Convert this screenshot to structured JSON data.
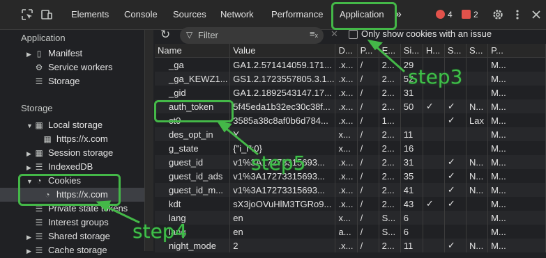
{
  "toolbar_icons": [
    "inspect-icon",
    "device-toggle-icon"
  ],
  "tabs": [
    {
      "label": "Elements"
    },
    {
      "label": "Console"
    },
    {
      "label": "Sources"
    },
    {
      "label": "Network"
    },
    {
      "label": "Performance"
    },
    {
      "label": "Application"
    }
  ],
  "more_tabs": "»",
  "errors": {
    "count": "4",
    "color": "#e2524b"
  },
  "issues": {
    "count": "2",
    "color": "#e2524b"
  },
  "sidebar": {
    "application_heading": "Application",
    "application_items": [
      {
        "label": "Manifest",
        "icon": "document-icon"
      },
      {
        "label": "Service workers",
        "icon": "gear-icon"
      },
      {
        "label": "Storage",
        "icon": "database-icon"
      }
    ],
    "storage_heading": "Storage",
    "storage_items": [
      {
        "label": "Local storage",
        "icon": "grid-icon"
      },
      {
        "label": "https://x.com",
        "icon": "grid-icon"
      },
      {
        "label": "Session storage",
        "icon": "grid-icon"
      },
      {
        "label": "IndexedDB",
        "icon": "database-icon"
      },
      {
        "label": "Cookies",
        "icon": "cookie-icon"
      },
      {
        "label": "https://x.com",
        "icon": "cookie-icon"
      },
      {
        "label": "Private state tokens",
        "icon": "database-icon"
      },
      {
        "label": "Interest groups",
        "icon": "database-icon"
      },
      {
        "label": "Shared storage",
        "icon": "database-icon"
      },
      {
        "label": "Cache storage",
        "icon": "database-icon"
      }
    ]
  },
  "filter": {
    "placeholder": "Filter"
  },
  "issue_checkbox_label": "Only show cookies with an issue",
  "columns": [
    "Name",
    "Value",
    "D...",
    "P...",
    "E...",
    "Si...",
    "H...",
    "S...",
    "S...",
    "P..."
  ],
  "rows": [
    [
      "_ga",
      "GA1.2.571414059.171...",
      ".x...",
      "/",
      "2...",
      "29",
      "",
      "",
      "",
      "M..."
    ],
    [
      "_ga_KEWZ1...",
      "GS1.2.1723557805.3.1...",
      ".x...",
      "/",
      "2...",
      "52",
      "",
      "",
      "",
      "M..."
    ],
    [
      "_gid",
      "GA1.2.1892543147.17...",
      ".x...",
      "/",
      "2...",
      "31",
      "",
      "",
      "",
      "M..."
    ],
    [
      "auth_token",
      "5f45eda1b32ec30c38f...",
      ".x...",
      "/",
      "2...",
      "50",
      "✓",
      "✓",
      "N...",
      "M..."
    ],
    [
      "ct0",
      "3585a38c8af0b6d784...",
      ".x...",
      "/",
      "1...",
      "",
      "",
      "✓",
      "Lax",
      "M..."
    ],
    [
      "des_opt_in",
      "Y",
      "x...",
      "/",
      "2...",
      "11",
      "",
      "",
      "",
      "M..."
    ],
    [
      "g_state",
      "{\"i_l\":0}",
      "x...",
      "/",
      "2...",
      "16",
      "",
      "",
      "",
      "M..."
    ],
    [
      "guest_id",
      "v1%3A17273315693...",
      ".x...",
      "/",
      "2...",
      "31",
      "",
      "✓",
      "N...",
      "M..."
    ],
    [
      "guest_id_ads",
      "v1%3A17273315693...",
      ".x...",
      "/",
      "2...",
      "35",
      "",
      "✓",
      "N...",
      "M..."
    ],
    [
      "guest_id_m...",
      "v1%3A17273315693...",
      ".x...",
      "/",
      "2...",
      "41",
      "",
      "✓",
      "N...",
      "M..."
    ],
    [
      "kdt",
      "sX3joOVuHlM3TGRo9...",
      ".x...",
      "/",
      "2...",
      "43",
      "✓",
      "✓",
      "",
      "M..."
    ],
    [
      "lang",
      "en",
      "x...",
      "/",
      "S...",
      "6",
      "",
      "",
      "",
      "M..."
    ],
    [
      "lang",
      "en",
      "a...",
      "/",
      "S...",
      "6",
      "",
      "",
      "",
      "M..."
    ],
    [
      "night_mode",
      "2",
      ".x...",
      "/",
      "2...",
      "11",
      "",
      "✓",
      "N...",
      "M..."
    ]
  ],
  "annotations": {
    "step3": "step3",
    "step4": "step4",
    "step5": "step5",
    "color": "#44b848"
  }
}
